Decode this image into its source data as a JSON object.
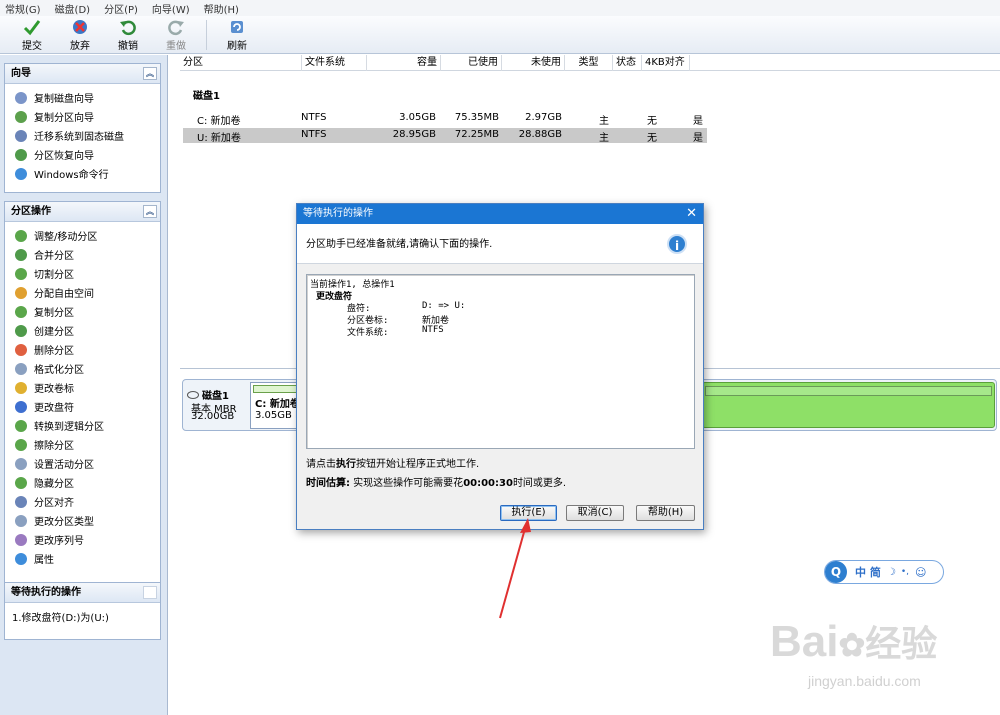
{
  "menu": [
    "常规(G)",
    "磁盘(D)",
    "分区(P)",
    "向导(W)",
    "帮助(H)"
  ],
  "toolbar": {
    "submit": "提交",
    "discard": "放弃",
    "undo": "撤销",
    "redo": "重做",
    "refresh": "刷新"
  },
  "wizard": {
    "title": "向导",
    "items": [
      "复制磁盘向导",
      "复制分区向导",
      "迁移系统到固态磁盘",
      "分区恢复向导",
      "Windows命令行"
    ]
  },
  "partops": {
    "title": "分区操作",
    "items": [
      "调整/移动分区",
      "合并分区",
      "切割分区",
      "分配自由空间",
      "复制分区",
      "创建分区",
      "删除分区",
      "格式化分区",
      "更改卷标",
      "更改盘符",
      "转换到逻辑分区",
      "擦除分区",
      "设置活动分区",
      "隐藏分区",
      "分区对齐",
      "更改分区类型",
      "更改序列号",
      "属性"
    ]
  },
  "pending": {
    "title": "等待执行的操作",
    "items": [
      "1.修改盘符(D:)为(U:)"
    ]
  },
  "table": {
    "headers": [
      "分区",
      "文件系统",
      "容量",
      "已使用",
      "未使用",
      "类型",
      "状态",
      "4KB对齐"
    ],
    "disk": "磁盘1",
    "rows": [
      [
        "C: 新加卷",
        "NTFS",
        "3.05GB",
        "75.35MB",
        "2.97GB",
        "主",
        "无",
        "是"
      ],
      [
        "U: 新加卷",
        "NTFS",
        "28.95GB",
        "72.25MB",
        "28.88GB",
        "主",
        "无",
        "是"
      ]
    ]
  },
  "diskmap": {
    "name": "磁盘1",
    "type": "基本 MBR",
    "size": "32.00GB",
    "part_label": "C: 新加卷",
    "part_size": "3.05GB N"
  },
  "dialog": {
    "title": "等待执行的操作",
    "banner": "分区助手已经准备就绪,请确认下面的操作.",
    "list_header": "当前操作1, 总操作1",
    "op_title": "更改盘符",
    "fields": [
      [
        "盘符:",
        "D: => U:"
      ],
      [
        "分区卷标:",
        "新加卷"
      ],
      [
        "文件系统:",
        "NTFS"
      ]
    ],
    "note_pre": "请点击",
    "note_bold": "执行",
    "note_post": "按钮开始让程序正式地工作.",
    "time_label": "时间估算:",
    "time_text": " 实现这些操作可能需要花",
    "time_value": "00:00:30",
    "time_post": "时间或更多.",
    "execute": "执行(E)",
    "cancel": "取消(C)",
    "help": "帮助(H)"
  },
  "ime": {
    "chars": "中 简"
  },
  "watermark": {
    "brand": "Bai",
    "brand2": "经验",
    "url": "jingyan.baidu.com"
  },
  "colors": {
    "accent": "#1b76d3",
    "partition_green": "#8ee067",
    "arrow": "#e03030"
  }
}
